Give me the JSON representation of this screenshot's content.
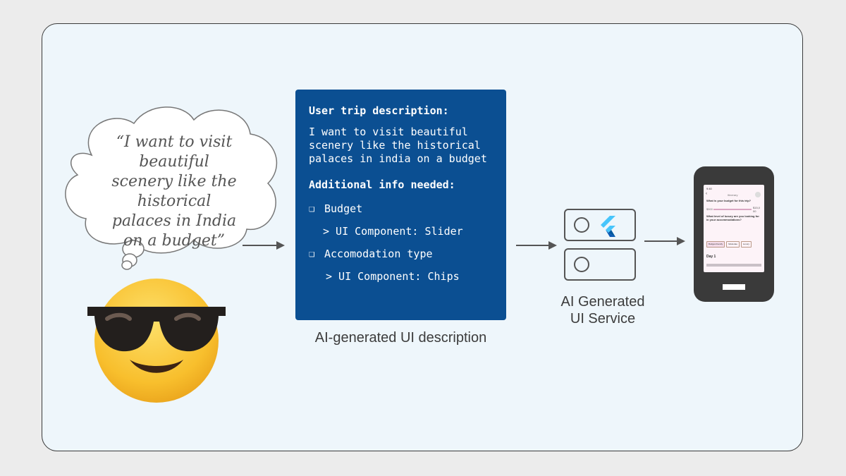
{
  "thought_bubble": {
    "quote_lines": [
      "“I want to visit beautiful",
      "scenery like the historical",
      "palaces in India",
      "on a budget”"
    ]
  },
  "ui_description": {
    "heading_trip": "User trip description:",
    "trip_text": "I want to visit beautiful scenery like the historical palaces in india on a budget",
    "heading_info": "Additional info needed:",
    "items": [
      {
        "label": "Budget",
        "component": "> UI Component: Slider"
      },
      {
        "label": "Accomodation type",
        "component": "> UI Component: Chips"
      }
    ],
    "checkbox_glyph": "❏",
    "caption": "AI-generated UI description"
  },
  "service": {
    "caption_line1": "AI Generated",
    "caption_line2": "UI Service",
    "logo": "flutter-logo-icon"
  },
  "phone_screen": {
    "time": "9:40",
    "title": "Itinerary",
    "q1": "What is your budget for this trip?",
    "slider_min": "$500",
    "slider_val": "$15,0 00",
    "q2": "What level of luxury are you looking for in your accommodations?",
    "chips": [
      "Budget-friendly",
      "Moderate",
      "Luxury"
    ],
    "day": "Day 1"
  },
  "colors": {
    "box_blue": "#0b4f92",
    "card_bg": "#eef6fb",
    "arrow": "#555555"
  }
}
